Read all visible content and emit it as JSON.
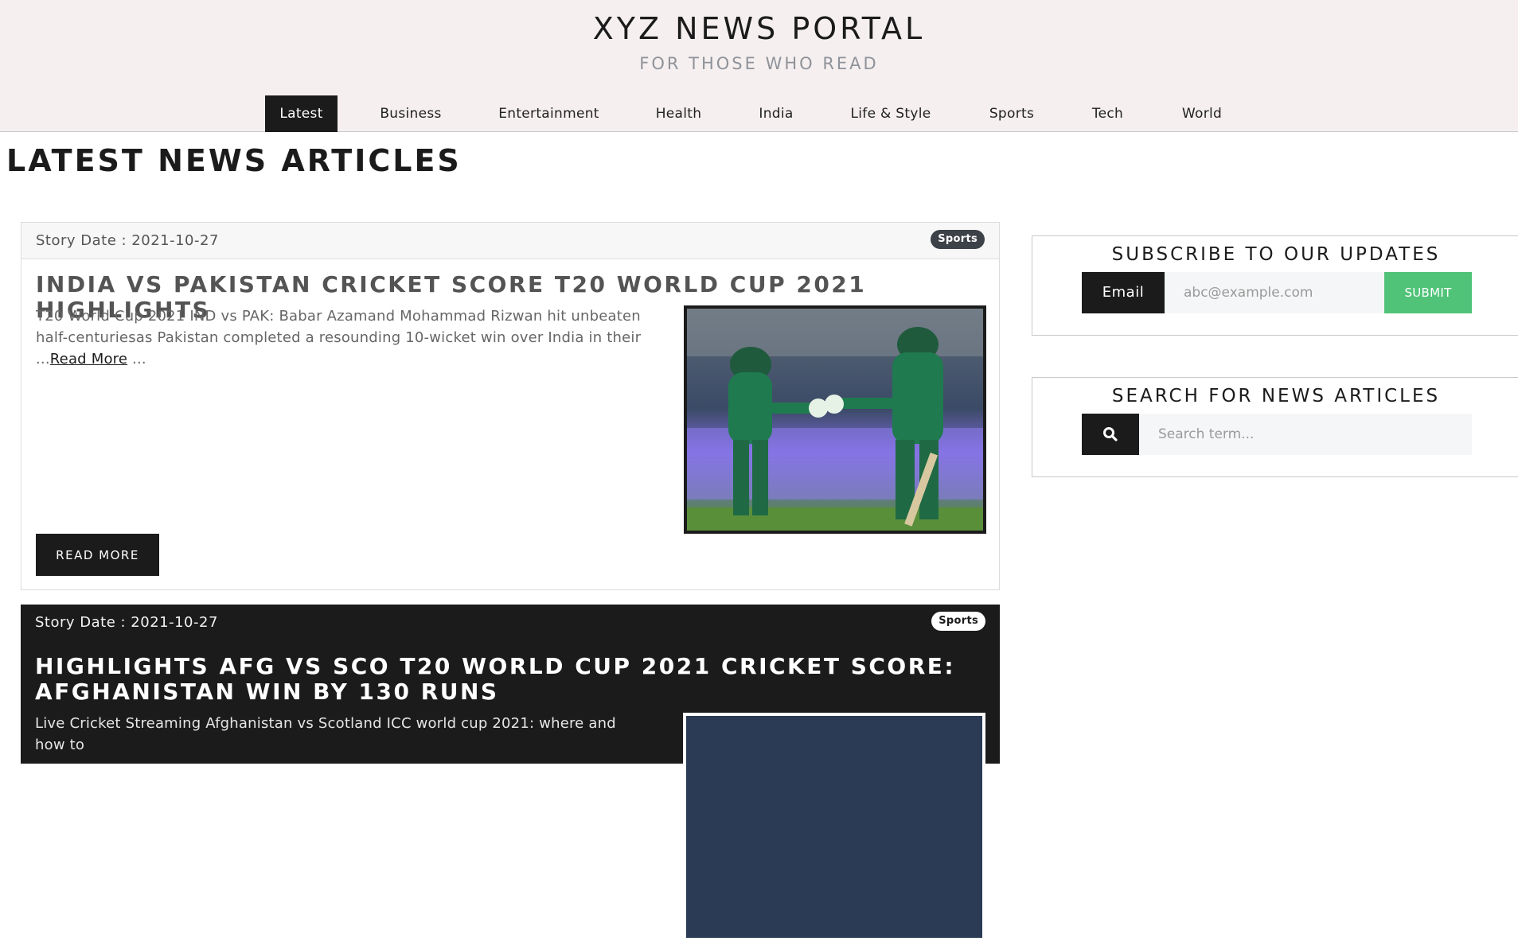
{
  "header": {
    "title": "XYZ NEWS PORTAL",
    "tagline": "FOR THOSE WHO READ"
  },
  "nav": {
    "items": [
      {
        "label": "Latest",
        "active": true
      },
      {
        "label": "Business",
        "active": false
      },
      {
        "label": "Entertainment",
        "active": false
      },
      {
        "label": "Health",
        "active": false
      },
      {
        "label": "India",
        "active": false
      },
      {
        "label": "Life & Style",
        "active": false
      },
      {
        "label": "Sports",
        "active": false
      },
      {
        "label": "Tech",
        "active": false
      },
      {
        "label": "World",
        "active": false
      }
    ]
  },
  "main": {
    "heading": "LATEST NEWS ARTICLES",
    "articles": [
      {
        "story_date": "Story Date : 2021-10-27",
        "category": "Sports",
        "title": "INDIA VS PAKISTAN CRICKET SCORE T20 WORLD CUP 2021 HIGHLIGHTS",
        "excerpt": "T20 World Cup 2021 IND vs PAK: Babar Azamand Mohammad Rizwan hit unbeaten half-centuriesas Pakistan completed a resounding 10-wicket win over India in their ...",
        "read_more_link": "Read More",
        "excerpt_tail": " ...",
        "button_label": "READ MORE",
        "theme": "light"
      },
      {
        "story_date": "Story Date : 2021-10-27",
        "category": "Sports",
        "title": "HIGHLIGHTS AFG VS SCO T20 WORLD CUP 2021 CRICKET SCORE: AFGHANISTAN WIN BY 130 RUNS",
        "excerpt": "Live Cricket Streaming Afghanistan vs Scotland ICC world cup 2021: where and how to",
        "theme": "dark"
      }
    ]
  },
  "sidebar": {
    "subscribe": {
      "title": "SUBSCRIBE TO OUR UPDATES",
      "email_label": "Email",
      "email_placeholder": "abc@example.com",
      "submit_label": "SUBMIT"
    },
    "search": {
      "title": "SEARCH FOR NEWS ARTICLES",
      "icon": "search-icon",
      "placeholder": "Search term..."
    }
  },
  "colors": {
    "header_bg": "#f5efef",
    "accent_dark": "#1b1b1b",
    "submit_green": "#50c378",
    "badge_dark": "#3d4248"
  }
}
